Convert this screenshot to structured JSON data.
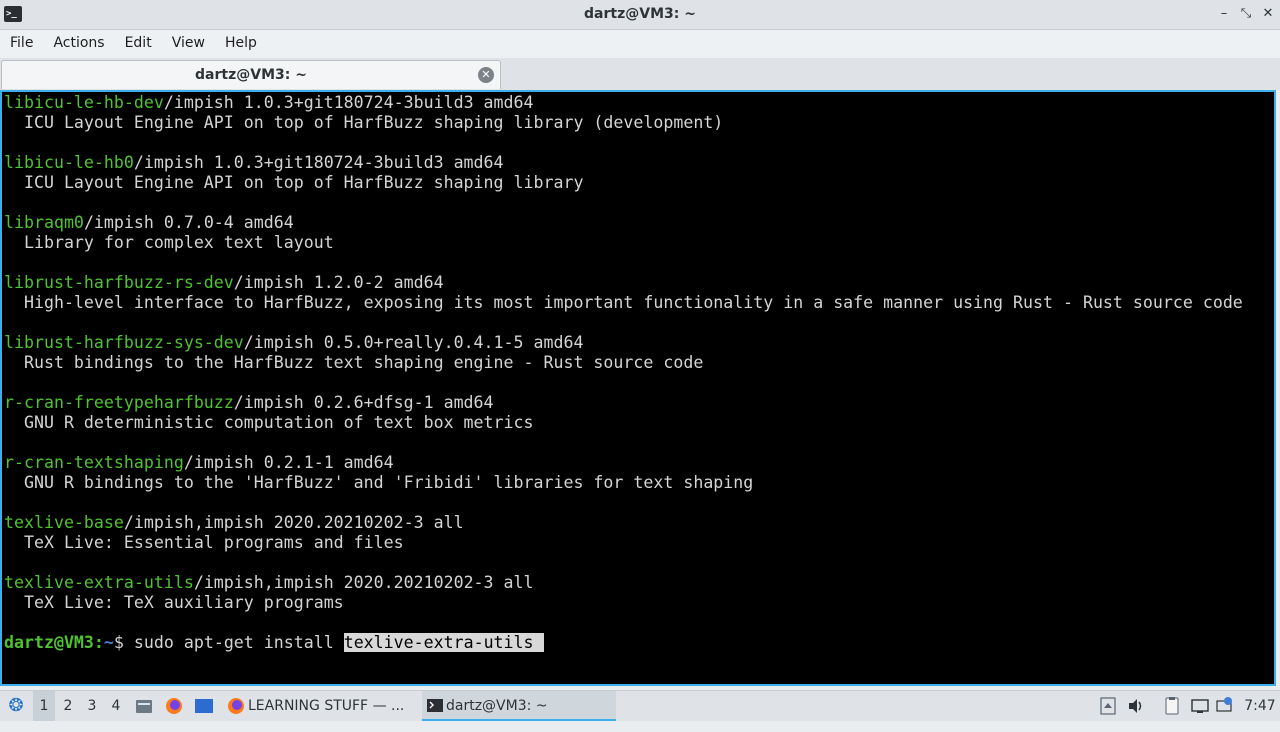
{
  "window": {
    "title": "dartz@VM3: ~",
    "app_icon_glyph": ">_",
    "controls": {
      "minimize": "–",
      "maximize": "⤡",
      "close": "✕"
    }
  },
  "menu": [
    "File",
    "Actions",
    "Edit",
    "View",
    "Help"
  ],
  "tab": {
    "label": "dartz@VM3: ~",
    "close_glyph": "✕"
  },
  "terminal": {
    "lines": [
      {
        "pkg": "libicu-le-hb-dev",
        "rest": "/impish 1.0.3+git180724-3build3 amd64"
      },
      {
        "text": "  ICU Layout Engine API on top of HarfBuzz shaping library (development)"
      },
      {
        "text": ""
      },
      {
        "pkg": "libicu-le-hb0",
        "rest": "/impish 1.0.3+git180724-3build3 amd64"
      },
      {
        "text": "  ICU Layout Engine API on top of HarfBuzz shaping library"
      },
      {
        "text": ""
      },
      {
        "pkg": "libraqm0",
        "rest": "/impish 0.7.0-4 amd64"
      },
      {
        "text": "  Library for complex text layout"
      },
      {
        "text": ""
      },
      {
        "pkg": "librust-harfbuzz-rs-dev",
        "rest": "/impish 1.2.0-2 amd64"
      },
      {
        "text": "  High-level interface to HarfBuzz, exposing its most important functionality in a safe manner using Rust - Rust source code"
      },
      {
        "text": ""
      },
      {
        "pkg": "librust-harfbuzz-sys-dev",
        "rest": "/impish 0.5.0+really.0.4.1-5 amd64"
      },
      {
        "text": "  Rust bindings to the HarfBuzz text shaping engine - Rust source code"
      },
      {
        "text": ""
      },
      {
        "pkg": "r-cran-freetypeharfbuzz",
        "rest": "/impish 0.2.6+dfsg-1 amd64"
      },
      {
        "text": "  GNU R deterministic computation of text box metrics"
      },
      {
        "text": ""
      },
      {
        "pkg": "r-cran-textshaping",
        "rest": "/impish 0.2.1-1 amd64"
      },
      {
        "text": "  GNU R bindings to the 'HarfBuzz' and 'Fribidi' libraries for text shaping"
      },
      {
        "text": ""
      },
      {
        "pkg": "texlive-base",
        "rest": "/impish,impish 2020.20210202-3 all"
      },
      {
        "text": "  TeX Live: Essential programs and files"
      },
      {
        "text": ""
      },
      {
        "pkg": "texlive-extra-utils",
        "rest": "/impish,impish 2020.20210202-3 all"
      },
      {
        "text": "  TeX Live: TeX auxiliary programs"
      },
      {
        "text": ""
      }
    ],
    "prompt": {
      "user_host": "dartz@VM3",
      "colon": ":",
      "path": "~",
      "symbol": "$ ",
      "command": "sudo apt-get install ",
      "selection": "texlive-extra-utils "
    }
  },
  "taskbar": {
    "start_glyph": "❂",
    "workspaces": [
      "1",
      "2",
      "3",
      "4"
    ],
    "active_workspace": "1",
    "tasks": [
      {
        "label": "LEARNING STUFF — ...",
        "icon": "firefox-icon",
        "active": false
      },
      {
        "label": "dartz@VM3: ~",
        "icon": "terminal-icon",
        "active": true
      }
    ],
    "clock": "7:47"
  },
  "colors": {
    "package_name": "#4fc22f",
    "prompt_path": "#4b7fd6",
    "terminal_bg": "#000000",
    "focus_border": "#3daee9"
  }
}
